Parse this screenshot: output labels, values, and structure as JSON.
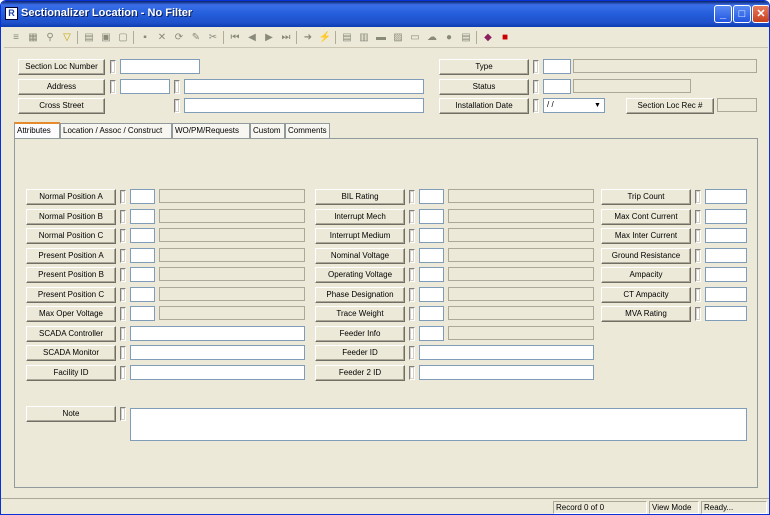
{
  "window": {
    "title": "Sectionalizer Location - No Filter",
    "app_icon_glyph": "R"
  },
  "toolbar": {
    "icons": [
      "list-icon",
      "grid-icon",
      "binoculars-icon",
      "filter-icon",
      "new-record-icon",
      "copy-icon",
      "paste-icon",
      "save-icon",
      "delete-icon",
      "refresh-icon",
      "edit-icon",
      "cut-icon",
      "first-record-icon",
      "prev-record-icon",
      "next-record-icon",
      "last-record-icon",
      "goto-icon",
      "lightning-icon",
      "report-icon",
      "tree-icon",
      "map-icon",
      "chart-icon",
      "layers-icon",
      "cloud-icon",
      "globe-icon",
      "options-icon",
      "books-icon",
      "exit-icon"
    ]
  },
  "header": {
    "section_loc_number": "Section Loc Number",
    "address": "Address",
    "cross_street": "Cross Street",
    "type": "Type",
    "status": "Status",
    "installation_date": "Installation Date",
    "installation_date_value": " / /",
    "section_loc_rec": "Section Loc Rec #"
  },
  "tabs": [
    "Attributes",
    "Location / Assoc / Construct",
    "WO/PM/Requests",
    "Custom",
    "Comments"
  ],
  "attributes": {
    "col1": [
      "Normal Position A",
      "Normal Position B",
      "Normal Position C",
      "Present Position A",
      "Present Position B",
      "Present Position C",
      "Max Oper Voltage",
      "SCADA Controller",
      "SCADA Monitor",
      "Facility ID"
    ],
    "col2": [
      "BIL Rating",
      "Interrupt Mech",
      "Interrupt Medium",
      "Nominal Voltage",
      "Operating Voltage",
      "Phase Designation",
      "Trace Weight",
      "Feeder Info",
      "Feeder ID",
      "Feeder 2 ID"
    ],
    "col3": [
      "Trip Count",
      "Max Cont Current",
      "Max Inter Current",
      "Ground Resistance",
      "Ampacity",
      "CT Ampacity",
      "MVA Rating"
    ],
    "note": "Note"
  },
  "statusbar": {
    "record": "Record 0 of 0",
    "mode": "View Mode",
    "state": "Ready..."
  }
}
